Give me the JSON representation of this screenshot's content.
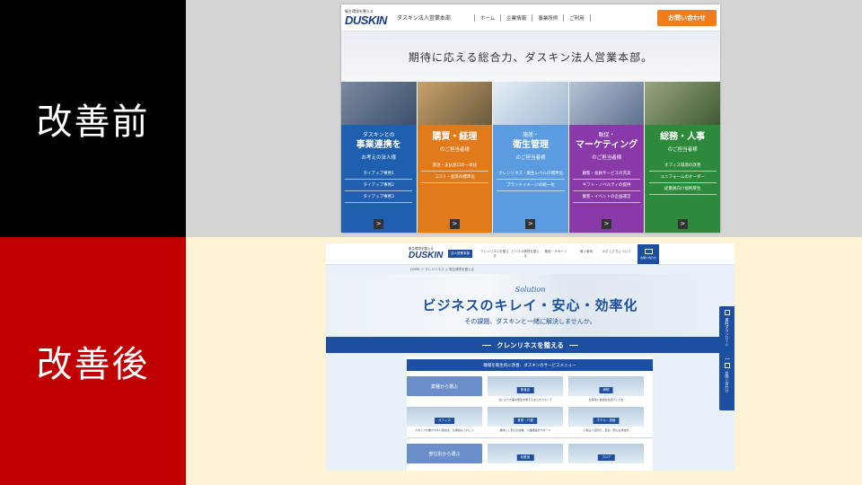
{
  "slide": {
    "before_label": "改善前",
    "after_label": "改善後",
    "colors": {
      "before_label_bg": "#000000",
      "after_label_bg": "#c00000",
      "top_bg": "#d4d4d4",
      "bottom_bg": "#fff3d6"
    }
  },
  "before": {
    "logo_tagline": "衛生環境を整える",
    "logo_word": "DUSKIN",
    "site_name": "ダスキン法人営業本部",
    "nav": [
      "ホーム",
      "企業情報",
      "事業所例",
      "ご利用",
      ""
    ],
    "contact_button": "お問い合わせ",
    "hero_text": "期待に応える総合力、ダスキン法人営業本部。",
    "cards": [
      {
        "pre": "ダスキンとの",
        "title": "事業連携を",
        "sub": "お考えの法人様",
        "color": "#1f5fb0",
        "links": [
          "タイアップ事例1",
          "タイアップ事例2",
          "タイアップ事例3"
        ]
      },
      {
        "pre": "",
        "title": "購買・経理",
        "sub": "のご担当者様",
        "color": "#e07a1a",
        "links": [
          "発注・支払窓口の一本化",
          "コスト・品質の標準化"
        ]
      },
      {
        "pre": "施設・",
        "title": "衛生管理",
        "sub": "のご担当者様",
        "color": "#5b9be0",
        "links": [
          "クレンリネス・衛生レベルの標準化",
          "ブランドイメージの統一化"
        ]
      },
      {
        "pre": "販促・",
        "title": "マーケティング",
        "sub": "のご担当者様",
        "color": "#8a3aa8",
        "links": [
          "顧客・会員サービスの充実",
          "ギフト・ノベルティの提供",
          "集客・イベントの企画運営"
        ]
      },
      {
        "pre": "",
        "title": "総務・人事",
        "sub": "のご担当者様",
        "color": "#2d8a3a",
        "links": [
          "オフィス環境の改善",
          "ユニフォームのオーダー",
          "従業員向け福利厚生"
        ]
      }
    ]
  },
  "after": {
    "logo_tagline": "衛生環境を整える",
    "logo_word": "DUSKIN",
    "badge": "法人営業本部",
    "nav": [
      "クレンリネスを整える",
      "ビジネス環境を整える",
      "販促・サポート",
      "導入事例",
      "わたしたちについて"
    ],
    "mail_label": "お問い合わせ",
    "breadcrumb": "HOME ＞ クレンリネス ＞ 衛生環境を整える",
    "hero_solution": "Solution",
    "hero_title": "ビジネスのキレイ・安心・効率化",
    "hero_sub": "その課題、ダスキンと一緒に解決しませんか。",
    "band_title": "クレンリネスを整える",
    "panel_head": "職場を衛生的に改善、ダスキンのサービスメニュー",
    "row1": {
      "category": "業種から選ぶ",
      "tiles": [
        "飲食店",
        "病院"
      ]
    },
    "row1_desc": [
      "",
      "なにより大事な衛生を整えるならダスキンで",
      "お客様に快適なお店づくりを"
    ],
    "row2_tiles": [
      "オフィス",
      "食堂・介護",
      "ホテル・旅館"
    ],
    "row2_desc": [
      "スタッフの働きやすい環境を、お客様もうれしく",
      "美味しく安心の食堂、介護施設をサポート",
      "心地よい空間で、安全・安心な滞在を"
    ],
    "row3": {
      "category": "部位別から選ぶ",
      "tiles": [
        "化粧室",
        "フロア"
      ]
    },
    "side": [
      "資料ダウンロード",
      "お問い合わせ"
    ]
  }
}
